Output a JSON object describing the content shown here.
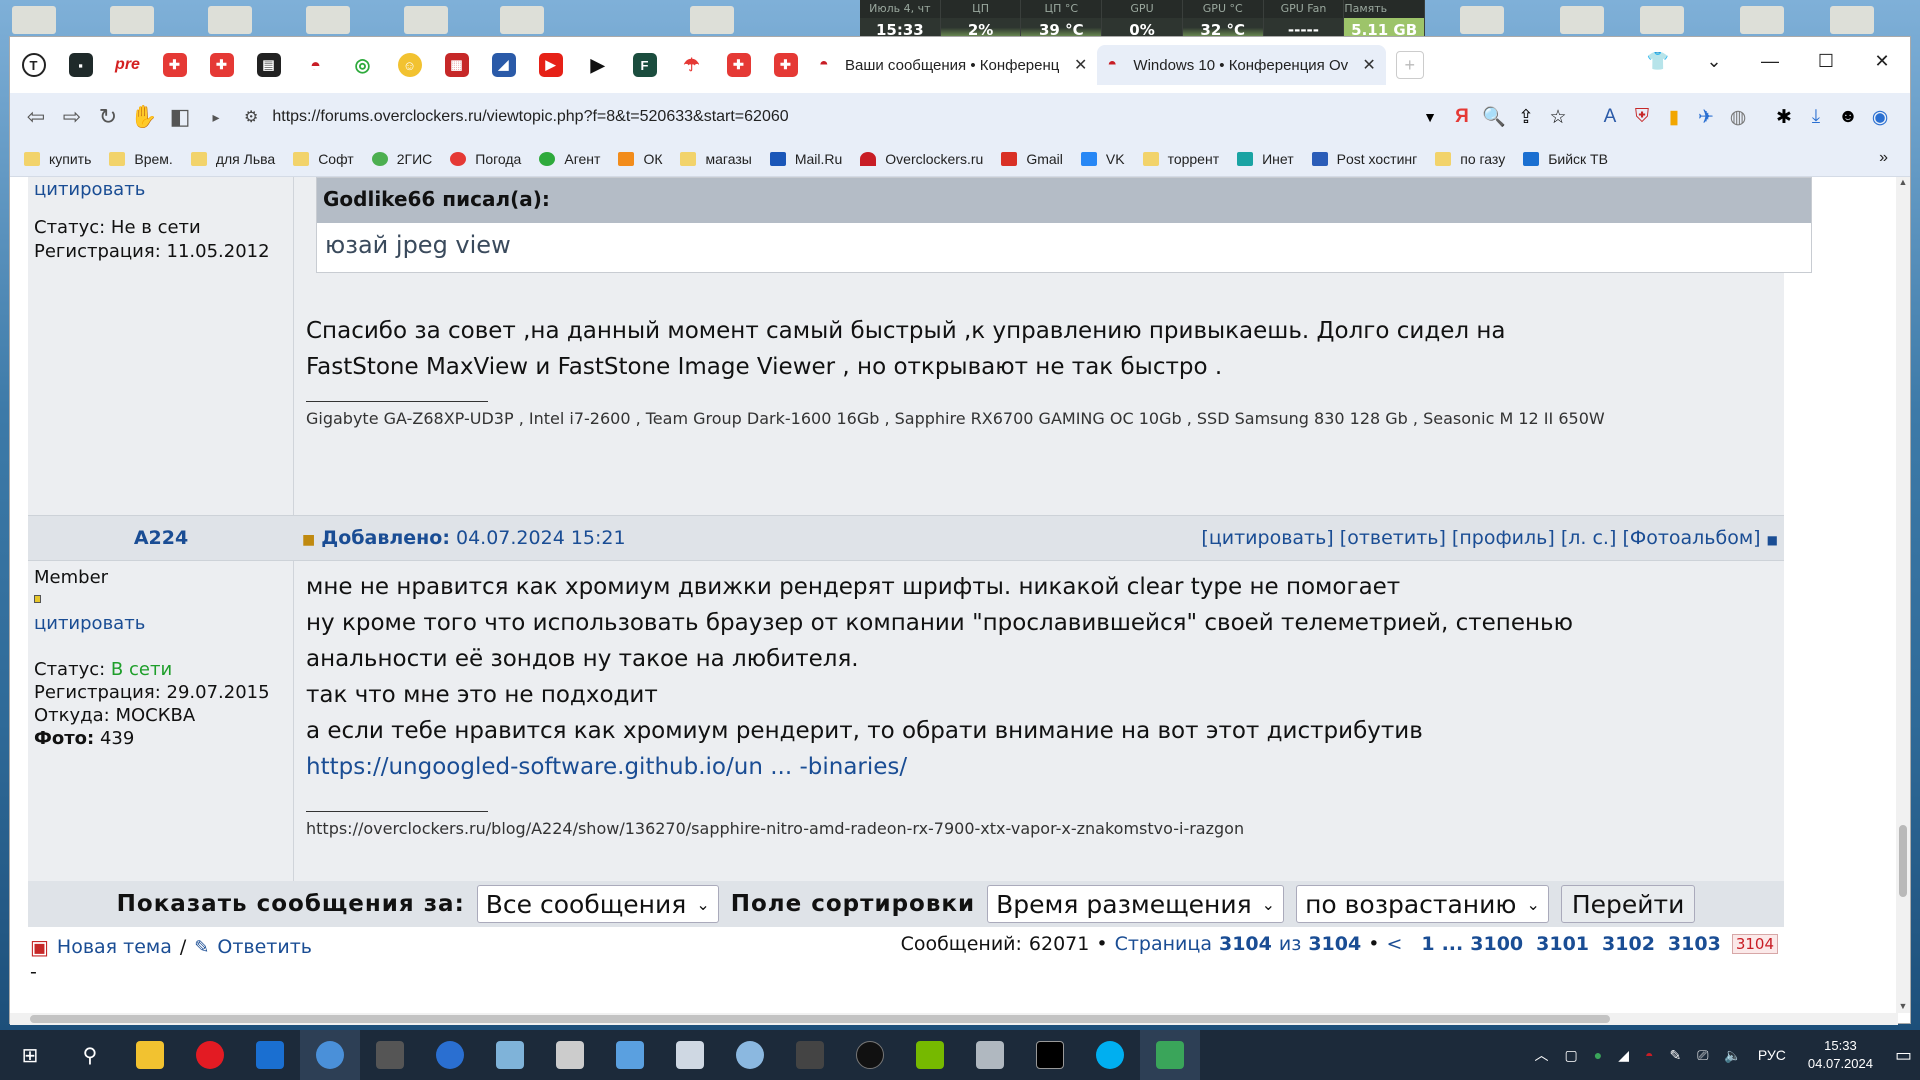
{
  "sysmon": [
    {
      "cap": "Июль 4, чт",
      "val": "15:33"
    },
    {
      "cap": "ЦП",
      "val": "2%"
    },
    {
      "cap": "ЦП °C",
      "val": "39 °C"
    },
    {
      "cap": "GPU",
      "val": "0%"
    },
    {
      "cap": "GPU °C",
      "val": "32 °C"
    },
    {
      "cap": "GPU Fan",
      "val": "-----"
    },
    {
      "cap": "Память использ.",
      "val": "5.11 GB"
    }
  ],
  "tabs": [
    {
      "label": "Ваши сообщения • Конференц",
      "active": false
    },
    {
      "label": "Windows 10 • Конференция Ov",
      "active": true
    }
  ],
  "address": {
    "url": "https://forums.overclockers.ru/viewtopic.php?f=8&t=520633&start=62060"
  },
  "bookmarks": [
    {
      "label": "купить",
      "color": "#f2d36b"
    },
    {
      "label": "Врем.",
      "color": "#f2d36b"
    },
    {
      "label": "для Льва",
      "color": "#f2d36b"
    },
    {
      "label": "Софт",
      "color": "#f2d36b"
    },
    {
      "label": "2ГИС",
      "color": "#4caf50"
    },
    {
      "label": "Погода",
      "color": "#e53935"
    },
    {
      "label": "Агент",
      "color": "#2eaa3c"
    },
    {
      "label": "ОК",
      "color": "#f28c1b"
    },
    {
      "label": "магазы",
      "color": "#f2d36b"
    },
    {
      "label": "Mail.Ru",
      "color": "#1a56b8"
    },
    {
      "label": "Overclockers.ru",
      "color": "#c81d25"
    },
    {
      "label": "Gmail",
      "color": "#d93025"
    },
    {
      "label": "VK",
      "color": "#2787f5"
    },
    {
      "label": "торрент",
      "color": "#f2d36b"
    },
    {
      "label": "Инет",
      "color": "#1aa3a3"
    },
    {
      "label": "Post хостинг",
      "color": "#2b5db8"
    },
    {
      "label": "по газу",
      "color": "#f2d36b"
    },
    {
      "label": "Бийск ТВ",
      "color": "#1a6fd1"
    }
  ],
  "post1": {
    "quote_link": "цитировать",
    "status_label": "Статус:",
    "status_value": "Не в сети",
    "reg_label": "Регистрация:",
    "reg_value": "11.05.2012",
    "quote_author": "Godlike66 писал(а):",
    "quote_text": "юзай jpeg view",
    "message_line1": "Спасибо за совет ,на данный момент самый быстрый ,к управлению привыкаешь. Долго сидел на",
    "message_line2": "FastStone MaxView и FastStone Image Viewer , но открывают не так быстро .",
    "signature": "Gigabyte GA-Z68XP-UD3P , Intel i7-2600 , Team Group Dark-1600 16Gb , Sapphire RX6700 GAMING OC 10Gb , SSD Samsung 830 128 Gb , Seasonic M 12 II 650W"
  },
  "post2": {
    "author": "A224",
    "added_label": "Добавлено:",
    "added_value": "04.07.2024 15:21",
    "actions": [
      "[цитировать]",
      "[ответить]",
      "[профиль]",
      "[л. с.]",
      "[Фотоальбом]"
    ],
    "rank": "Member",
    "quote_link": "цитировать",
    "status_label": "Статус:",
    "status_value": "В сети",
    "reg_label": "Регистрация:",
    "reg_value": "29.07.2015",
    "from_label": "Откуда:",
    "from_value": "МОСКВА",
    "photo_label": "Фото:",
    "photo_value": "439",
    "lines": [
      "мне не нравится как хромиум движки рендерят шрифты. никакой clear type не помогает",
      "ну кроме того что использовать браузер от компании \"прославившейся\" своей телеметрией, степенью",
      "анальности её зондов ну такое на любителя.",
      "так что мне это не подходит",
      "а если тебе нравится как хромиум рендерит, то обрати внимание на вот этот дистрибутив"
    ],
    "link": "https://ungoogled-software.github.io/un ... -binaries/",
    "signature": "https://overclockers.ru/blog/A224/show/136270/sapphire-nitro-amd-radeon-rx-7900-xtx-vapor-x-znakomstvo-i-razgon"
  },
  "filter": {
    "show_label": "Показать сообщения за:",
    "show_value": "Все сообщения",
    "sort_label": "Поле сортировки",
    "sort_value": "Время размещения",
    "order_value": "по возрастанию",
    "go_label": "Перейти"
  },
  "footer": {
    "new_topic": "Новая тема",
    "separator": "/",
    "reply": "Ответить",
    "dash": "-",
    "messages_label": "Сообщений:",
    "messages_count": "62071",
    "bullet": "•",
    "page_label": "Страница",
    "page_current": "3104",
    "of_label": "из",
    "page_total": "3104",
    "prev": "<",
    "pages": [
      "1",
      "...",
      "3100",
      "3101",
      "3102",
      "3103"
    ],
    "last_page": "3104"
  },
  "tray": {
    "lang": "РУС",
    "time": "15:33",
    "date": "04.07.2024"
  },
  "colors": {
    "online": "#1e9e2a",
    "link": "#1a4d94",
    "accent": "#c81d25"
  }
}
